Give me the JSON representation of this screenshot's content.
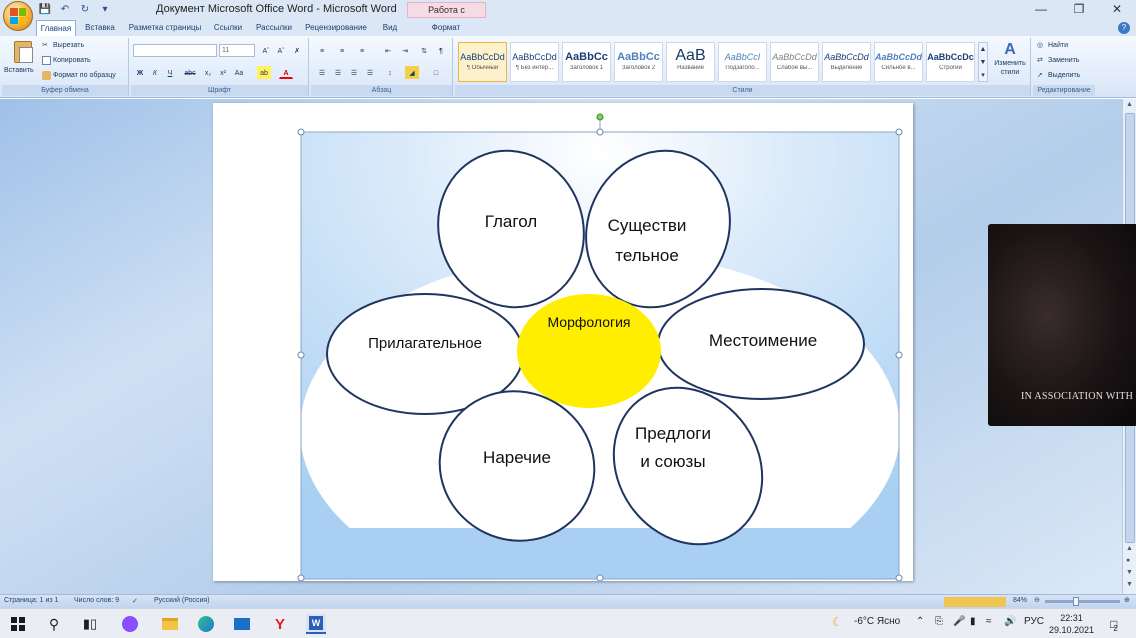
{
  "window": {
    "title": "Документ Microsoft Office Word - Microsoft Word",
    "context_tab": "Работа с рисунками"
  },
  "tabs": [
    "Главная",
    "Вставка",
    "Разметка страницы",
    "Ссылки",
    "Рассылки",
    "Рецензирование",
    "Вид",
    "Формат"
  ],
  "ribbon": {
    "clipboard": {
      "paste": "Вставить",
      "cut": "Вырезать",
      "copy": "Копировать",
      "format_painter": "Формат по образцу",
      "label": "Буфер обмена"
    },
    "font": {
      "size": "11",
      "label": "Шрифт"
    },
    "paragraph": {
      "label": "Абзац"
    },
    "styles": {
      "items": [
        {
          "preview": "AaBbCcDd",
          "name": "¶ Обычный"
        },
        {
          "preview": "AaBbCcDd",
          "name": "¶ Без интер..."
        },
        {
          "preview": "AaBbCc",
          "name": "Заголовок 1"
        },
        {
          "preview": "AaBbCc",
          "name": "Заголовок 2"
        },
        {
          "preview": "AaB",
          "name": "Название"
        },
        {
          "preview": "AaBbCcI",
          "name": "Подзаголо..."
        },
        {
          "preview": "AaBbCcDd",
          "name": "Слабое вы..."
        },
        {
          "preview": "AaBbCcDd",
          "name": "Выделение"
        },
        {
          "preview": "AaBbCcDd",
          "name": "Сильное в..."
        },
        {
          "preview": "AaBbCcDc",
          "name": "Строгий"
        }
      ],
      "change_styles": "Изменить стили",
      "label": "Стили"
    },
    "editing": {
      "find": "Найти",
      "replace": "Заменить",
      "select": "Выделить",
      "label": "Редактирование"
    }
  },
  "diagram": {
    "center": "Морфология",
    "petals": {
      "verb": "Глагол",
      "noun_line1": "Существи",
      "noun_line2": "тельное",
      "adjective": "Прилагательное",
      "pronoun": "Местоимение",
      "adverb": "Наречие",
      "prep_line1": "Предлоги",
      "prep_line2": "и союзы"
    },
    "colors": {
      "center": "#ffee00",
      "outline": "#1f3560",
      "sky": "#a9d0f2"
    }
  },
  "video": {
    "credit": "IN ASSOCIATION WITH BROI"
  },
  "status": {
    "page": "Страница: 1 из 1",
    "words": "Число слов: 9",
    "language": "Русский (Россия)",
    "zoom": "84%"
  },
  "taskbar": {
    "weather": "-6°C  Ясно",
    "lang": "РУС",
    "time": "22:31",
    "date": "29.10.2021",
    "notifications": "2"
  }
}
